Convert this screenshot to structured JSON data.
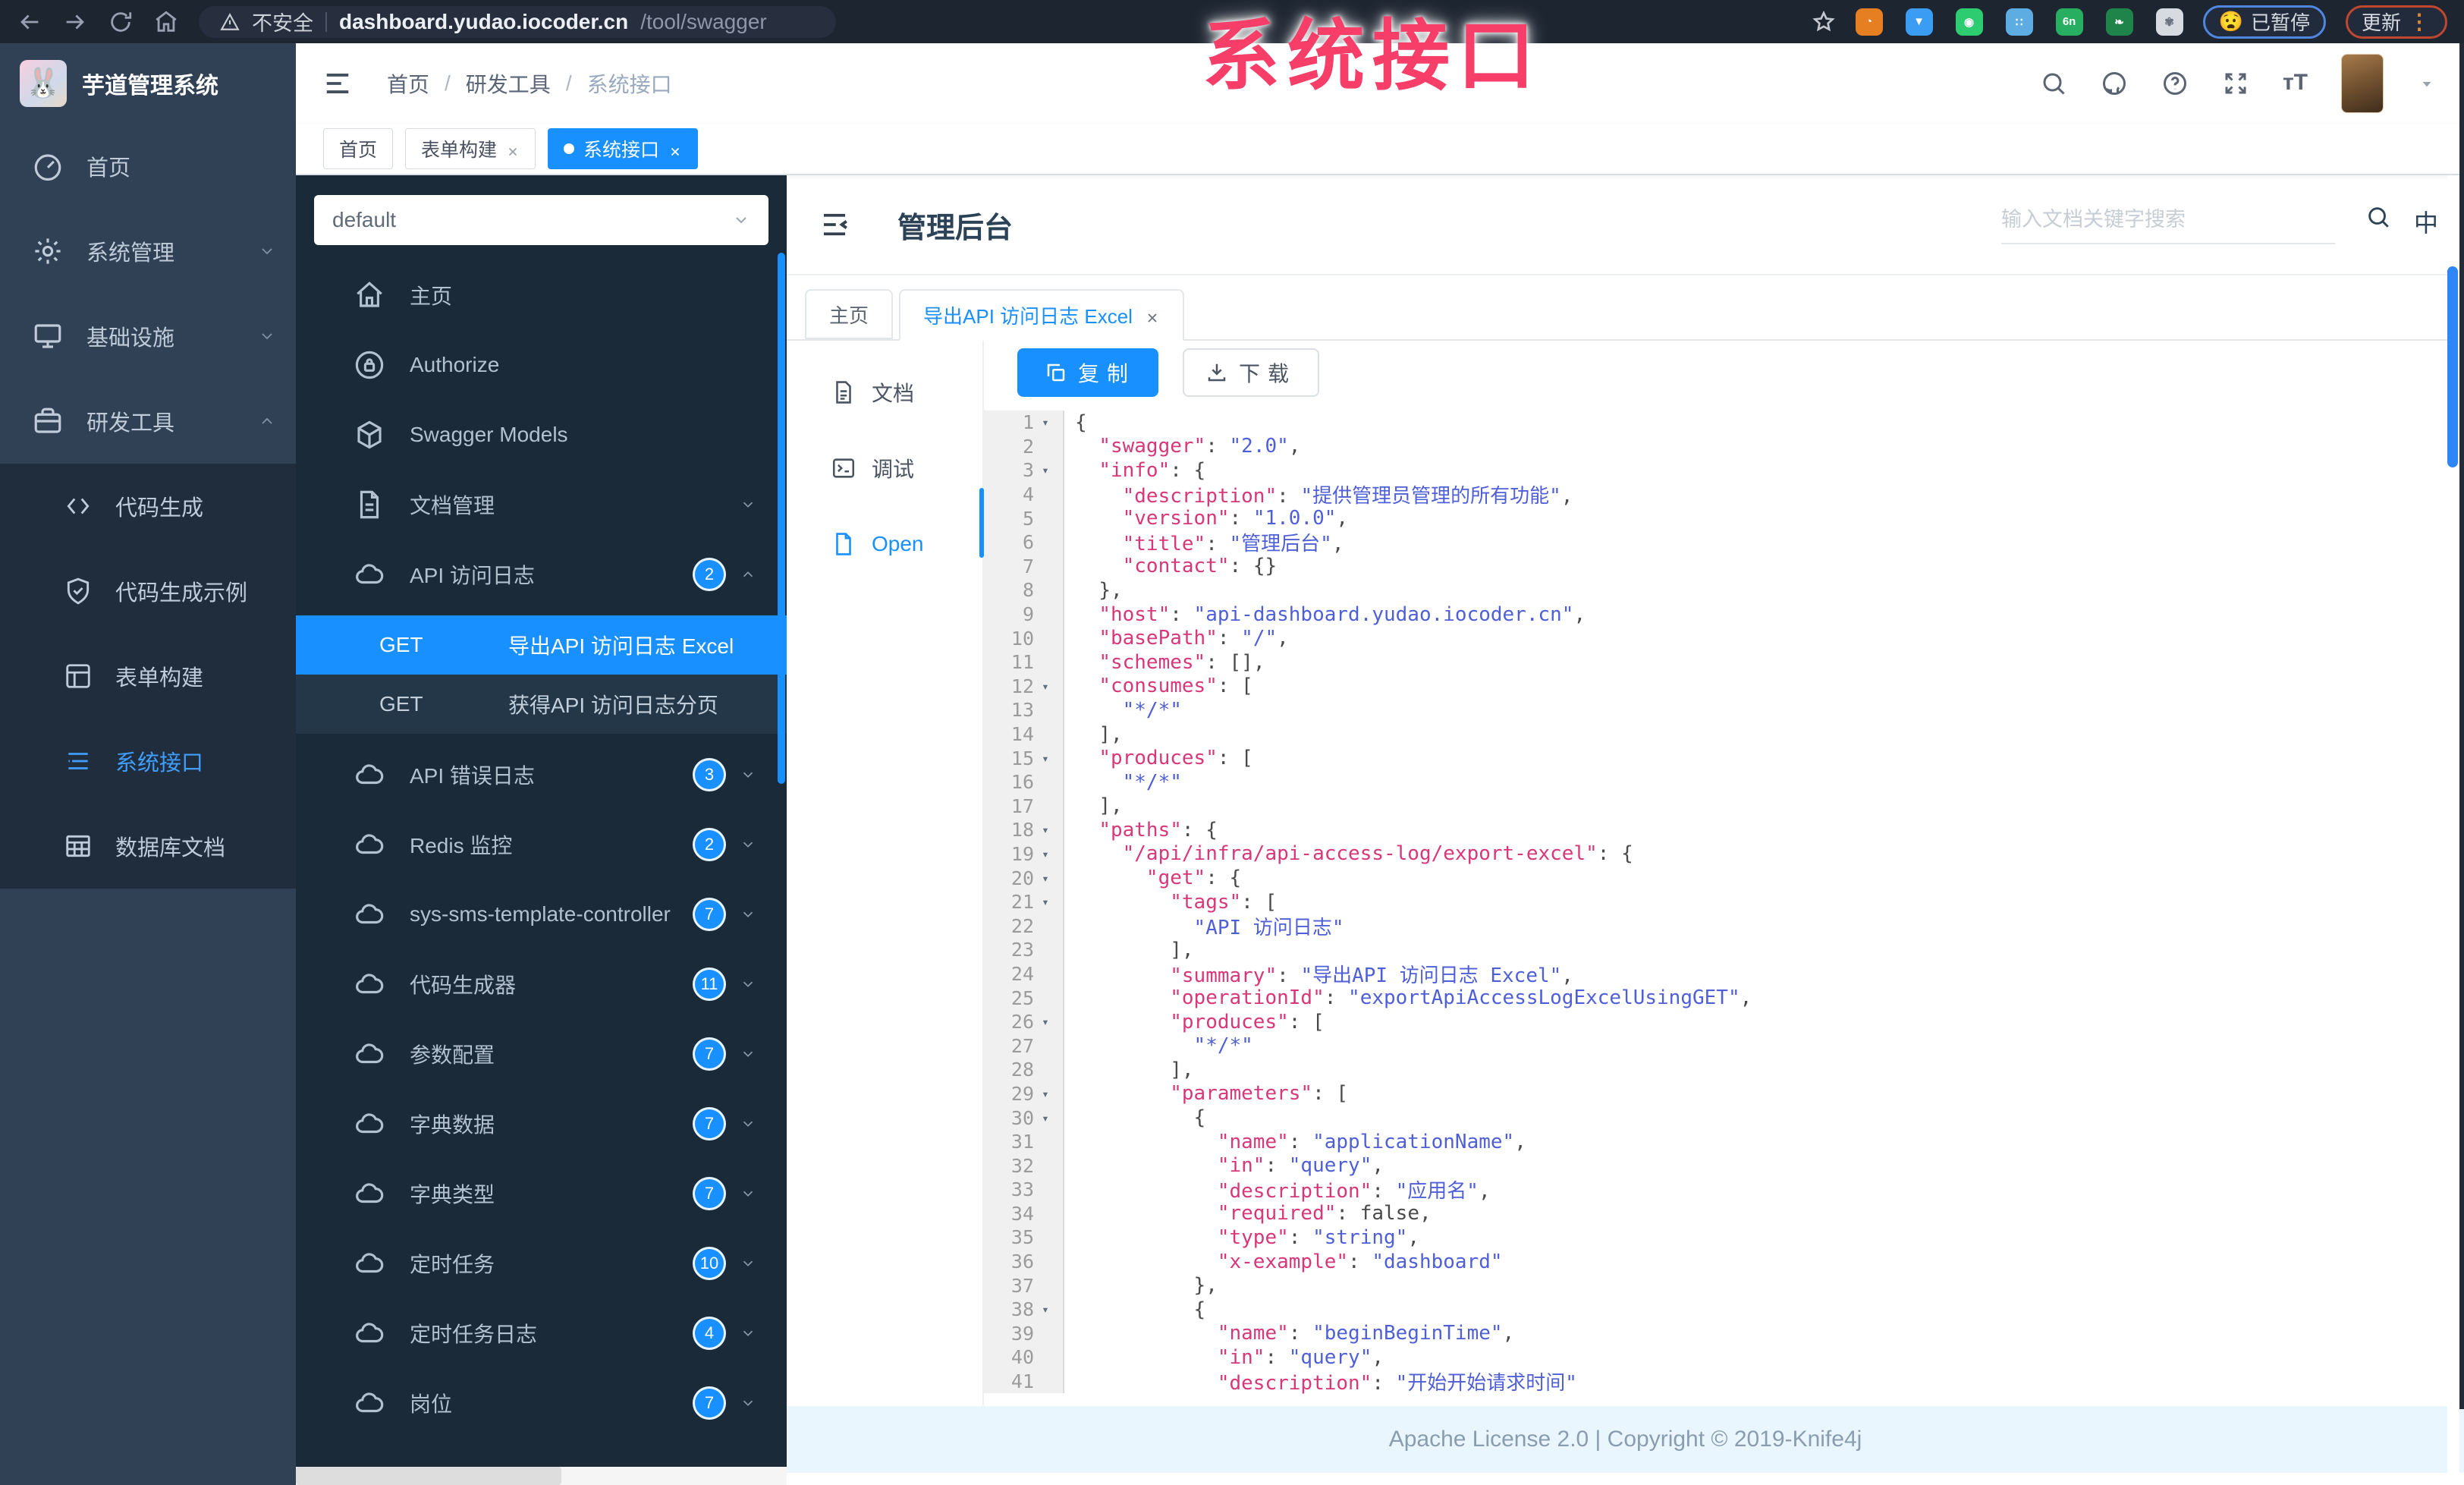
{
  "browser": {
    "security_label": "不安全",
    "url_host": "dashboard.yudao.iocoder.cn",
    "url_path": "/tool/swagger",
    "paused_label": "已暂停",
    "paused_emoji": "😧",
    "update_label": "更新",
    "extensions": [
      {
        "name": "orange-ring-extension",
        "color": "#e67e22",
        "glyph": "◔"
      },
      {
        "name": "blue-drop-extension",
        "color": "#3b9cf4",
        "glyph": "▼"
      },
      {
        "name": "green-shield-extension",
        "color": "#2ecc71",
        "glyph": "◉"
      },
      {
        "name": "blue-grid-extension",
        "color": "#5dade2",
        "glyph": "∷"
      },
      {
        "name": "green-6n-extension",
        "color": "#27ae60",
        "glyph": "6n"
      },
      {
        "name": "green-leaf-extension",
        "color": "#1e8449",
        "glyph": "❧"
      },
      {
        "name": "white-paw-extension",
        "color": "#d5dbe1",
        "glyph": "✾"
      }
    ]
  },
  "watermark": "系统接口",
  "sidebar": {
    "logo_title": "芋道管理系统",
    "logo_glyph": "🐰",
    "items": [
      {
        "icon": "dashboard-icon",
        "label": "首页"
      },
      {
        "icon": "gear-icon",
        "label": "系统管理",
        "chevron": "down"
      },
      {
        "icon": "infra-icon",
        "label": "基础设施",
        "chevron": "down"
      },
      {
        "icon": "tools-icon",
        "label": "研发工具",
        "chevron": "up",
        "expanded": true,
        "children": [
          {
            "icon": "code-icon",
            "label": "代码生成"
          },
          {
            "icon": "shield-check-icon",
            "label": "代码生成示例"
          },
          {
            "icon": "form-icon",
            "label": "表单构建"
          },
          {
            "icon": "api-icon",
            "label": "系统接口",
            "active": true
          },
          {
            "icon": "database-icon",
            "label": "数据库文档"
          }
        ]
      }
    ]
  },
  "breadcrumb": [
    "首页",
    "研发工具",
    "系统接口"
  ],
  "tagbar": {
    "tags": [
      {
        "label": "首页",
        "closable": false,
        "active": false
      },
      {
        "label": "表单构建",
        "closable": true,
        "active": false
      },
      {
        "label": "系统接口",
        "closable": true,
        "active": true
      }
    ]
  },
  "knife4j": {
    "group_value": "default",
    "menu": [
      {
        "icon": "home-icon",
        "label": "主页"
      },
      {
        "icon": "lock-icon",
        "label": "Authorize"
      },
      {
        "icon": "cube-icon",
        "label": "Swagger Models"
      },
      {
        "icon": "doc-icon",
        "label": "文档管理",
        "chevron": "down"
      },
      {
        "icon": "cloud-icon",
        "label": "API 访问日志",
        "badge": "2",
        "chevron": "up",
        "children": [
          {
            "method": "GET",
            "label": "导出API 访问日志 Excel",
            "active": true
          },
          {
            "method": "GET",
            "label": "获得API 访问日志分页",
            "active": false
          }
        ]
      },
      {
        "icon": "cloud-icon",
        "label": "API 错误日志",
        "badge": "3",
        "chevron": "down"
      },
      {
        "icon": "cloud-icon",
        "label": "Redis 监控",
        "badge": "2",
        "chevron": "down"
      },
      {
        "icon": "cloud-icon",
        "label": "sys-sms-template-controller",
        "badge": "7",
        "chevron": "down"
      },
      {
        "icon": "cloud-icon",
        "label": "代码生成器",
        "badge": "11",
        "chevron": "down"
      },
      {
        "icon": "cloud-icon",
        "label": "参数配置",
        "badge": "7",
        "chevron": "down"
      },
      {
        "icon": "cloud-icon",
        "label": "字典数据",
        "badge": "7",
        "chevron": "down"
      },
      {
        "icon": "cloud-icon",
        "label": "字典类型",
        "badge": "7",
        "chevron": "down"
      },
      {
        "icon": "cloud-icon",
        "label": "定时任务",
        "badge": "10",
        "chevron": "down"
      },
      {
        "icon": "cloud-icon",
        "label": "定时任务日志",
        "badge": "4",
        "chevron": "down"
      },
      {
        "icon": "cloud-icon",
        "label": "岗位",
        "badge": "7",
        "chevron": "down"
      }
    ]
  },
  "doc": {
    "title": "管理后台",
    "search_placeholder": "输入文档关键字搜索",
    "lang_icon": "中",
    "tabs": [
      {
        "label": "主页",
        "closable": false,
        "active": false
      },
      {
        "label": "导出API 访问日志 Excel",
        "closable": true,
        "active": true
      }
    ],
    "side_tabs": [
      {
        "icon": "file-text-icon",
        "label": "文档",
        "active": false
      },
      {
        "icon": "debug-icon",
        "label": "调试",
        "active": false
      },
      {
        "icon": "open-file-icon",
        "label": "Open",
        "active": true
      }
    ],
    "copy_label": "复制",
    "download_label": "下载"
  },
  "code": {
    "lines": [
      {
        "n": 1,
        "fold": 1,
        "ind": 0,
        "seg": [
          [
            "p",
            "{"
          ]
        ]
      },
      {
        "n": 2,
        "ind": 2,
        "seg": [
          [
            "k",
            "\"swagger\""
          ],
          [
            "p",
            ": "
          ],
          [
            "s",
            "\"2.0\""
          ],
          [
            "p",
            ","
          ]
        ]
      },
      {
        "n": 3,
        "fold": 1,
        "ind": 2,
        "seg": [
          [
            "k",
            "\"info\""
          ],
          [
            "p",
            ": {"
          ]
        ]
      },
      {
        "n": 4,
        "ind": 4,
        "seg": [
          [
            "k",
            "\"description\""
          ],
          [
            "p",
            ": "
          ],
          [
            "s",
            "\"提供管理员管理的所有功能\""
          ],
          [
            "p",
            ","
          ]
        ]
      },
      {
        "n": 5,
        "ind": 4,
        "seg": [
          [
            "k",
            "\"version\""
          ],
          [
            "p",
            ": "
          ],
          [
            "s",
            "\"1.0.0\""
          ],
          [
            "p",
            ","
          ]
        ]
      },
      {
        "n": 6,
        "ind": 4,
        "seg": [
          [
            "k",
            "\"title\""
          ],
          [
            "p",
            ": "
          ],
          [
            "s",
            "\"管理后台\""
          ],
          [
            "p",
            ","
          ]
        ]
      },
      {
        "n": 7,
        "ind": 4,
        "seg": [
          [
            "k",
            "\"contact\""
          ],
          [
            "p",
            ": {}"
          ]
        ]
      },
      {
        "n": 8,
        "ind": 2,
        "seg": [
          [
            "p",
            "},"
          ]
        ]
      },
      {
        "n": 9,
        "ind": 2,
        "seg": [
          [
            "k",
            "\"host\""
          ],
          [
            "p",
            ": "
          ],
          [
            "s",
            "\"api-dashboard.yudao.iocoder.cn\""
          ],
          [
            "p",
            ","
          ]
        ]
      },
      {
        "n": 10,
        "ind": 2,
        "seg": [
          [
            "k",
            "\"basePath\""
          ],
          [
            "p",
            ": "
          ],
          [
            "s",
            "\"/\""
          ],
          [
            "p",
            ","
          ]
        ]
      },
      {
        "n": 11,
        "ind": 2,
        "seg": [
          [
            "k",
            "\"schemes\""
          ],
          [
            "p",
            ": [],"
          ]
        ]
      },
      {
        "n": 12,
        "fold": 1,
        "ind": 2,
        "seg": [
          [
            "k",
            "\"consumes\""
          ],
          [
            "p",
            ": ["
          ]
        ]
      },
      {
        "n": 13,
        "ind": 4,
        "seg": [
          [
            "s",
            "\"*/*\""
          ]
        ]
      },
      {
        "n": 14,
        "ind": 2,
        "seg": [
          [
            "p",
            "],"
          ]
        ]
      },
      {
        "n": 15,
        "fold": 1,
        "ind": 2,
        "seg": [
          [
            "k",
            "\"produces\""
          ],
          [
            "p",
            ": ["
          ]
        ]
      },
      {
        "n": 16,
        "ind": 4,
        "seg": [
          [
            "s",
            "\"*/*\""
          ]
        ]
      },
      {
        "n": 17,
        "ind": 2,
        "seg": [
          [
            "p",
            "],"
          ]
        ]
      },
      {
        "n": 18,
        "fold": 1,
        "ind": 2,
        "seg": [
          [
            "k",
            "\"paths\""
          ],
          [
            "p",
            ": {"
          ]
        ]
      },
      {
        "n": 19,
        "fold": 1,
        "ind": 4,
        "seg": [
          [
            "k",
            "\"/api/infra/api-access-log/export-excel\""
          ],
          [
            "p",
            ": {"
          ]
        ]
      },
      {
        "n": 20,
        "fold": 1,
        "ind": 6,
        "seg": [
          [
            "k",
            "\"get\""
          ],
          [
            "p",
            ": {"
          ]
        ]
      },
      {
        "n": 21,
        "fold": 1,
        "ind": 8,
        "seg": [
          [
            "k",
            "\"tags\""
          ],
          [
            "p",
            ": ["
          ]
        ]
      },
      {
        "n": 22,
        "ind": 10,
        "seg": [
          [
            "s",
            "\"API 访问日志\""
          ]
        ]
      },
      {
        "n": 23,
        "ind": 8,
        "seg": [
          [
            "p",
            "],"
          ]
        ]
      },
      {
        "n": 24,
        "ind": 8,
        "seg": [
          [
            "k",
            "\"summary\""
          ],
          [
            "p",
            ": "
          ],
          [
            "s",
            "\"导出API 访问日志 Excel\""
          ],
          [
            "p",
            ","
          ]
        ]
      },
      {
        "n": 25,
        "ind": 8,
        "seg": [
          [
            "k",
            "\"operationId\""
          ],
          [
            "p",
            ": "
          ],
          [
            "s",
            "\"exportApiAccessLogExcelUsingGET\""
          ],
          [
            "p",
            ","
          ]
        ]
      },
      {
        "n": 26,
        "fold": 1,
        "ind": 8,
        "seg": [
          [
            "k",
            "\"produces\""
          ],
          [
            "p",
            ": ["
          ]
        ]
      },
      {
        "n": 27,
        "ind": 10,
        "seg": [
          [
            "s",
            "\"*/*\""
          ]
        ]
      },
      {
        "n": 28,
        "ind": 8,
        "seg": [
          [
            "p",
            "],"
          ]
        ]
      },
      {
        "n": 29,
        "fold": 1,
        "ind": 8,
        "seg": [
          [
            "k",
            "\"parameters\""
          ],
          [
            "p",
            ": ["
          ]
        ]
      },
      {
        "n": 30,
        "fold": 1,
        "ind": 10,
        "seg": [
          [
            "p",
            "{"
          ]
        ]
      },
      {
        "n": 31,
        "ind": 12,
        "seg": [
          [
            "k",
            "\"name\""
          ],
          [
            "p",
            ": "
          ],
          [
            "s",
            "\"applicationName\""
          ],
          [
            "p",
            ","
          ]
        ]
      },
      {
        "n": 32,
        "ind": 12,
        "seg": [
          [
            "k",
            "\"in\""
          ],
          [
            "p",
            ": "
          ],
          [
            "s",
            "\"query\""
          ],
          [
            "p",
            ","
          ]
        ]
      },
      {
        "n": 33,
        "ind": 12,
        "seg": [
          [
            "k",
            "\"description\""
          ],
          [
            "p",
            ": "
          ],
          [
            "s",
            "\"应用名\""
          ],
          [
            "p",
            ","
          ]
        ]
      },
      {
        "n": 34,
        "ind": 12,
        "seg": [
          [
            "k",
            "\"required\""
          ],
          [
            "p",
            ": "
          ],
          [
            "b",
            "false"
          ],
          [
            "p",
            ","
          ]
        ]
      },
      {
        "n": 35,
        "ind": 12,
        "seg": [
          [
            "k",
            "\"type\""
          ],
          [
            "p",
            ": "
          ],
          [
            "s",
            "\"string\""
          ],
          [
            "p",
            ","
          ]
        ]
      },
      {
        "n": 36,
        "ind": 12,
        "seg": [
          [
            "k",
            "\"x-example\""
          ],
          [
            "p",
            ": "
          ],
          [
            "s",
            "\"dashboard\""
          ]
        ]
      },
      {
        "n": 37,
        "ind": 10,
        "seg": [
          [
            "p",
            "},"
          ]
        ]
      },
      {
        "n": 38,
        "fold": 1,
        "ind": 10,
        "seg": [
          [
            "p",
            "{"
          ]
        ]
      },
      {
        "n": 39,
        "ind": 12,
        "seg": [
          [
            "k",
            "\"name\""
          ],
          [
            "p",
            ": "
          ],
          [
            "s",
            "\"beginBeginTime\""
          ],
          [
            "p",
            ","
          ]
        ]
      },
      {
        "n": 40,
        "ind": 12,
        "seg": [
          [
            "k",
            "\"in\""
          ],
          [
            "p",
            ": "
          ],
          [
            "s",
            "\"query\""
          ],
          [
            "p",
            ","
          ]
        ]
      },
      {
        "n": 41,
        "ind": 12,
        "seg": [
          [
            "k",
            "\"description\""
          ],
          [
            "p",
            ": "
          ],
          [
            "s",
            "\"开始开始请求时间\""
          ]
        ]
      }
    ]
  },
  "footer": "Apache License 2.0 | Copyright © 2019-Knife4j"
}
